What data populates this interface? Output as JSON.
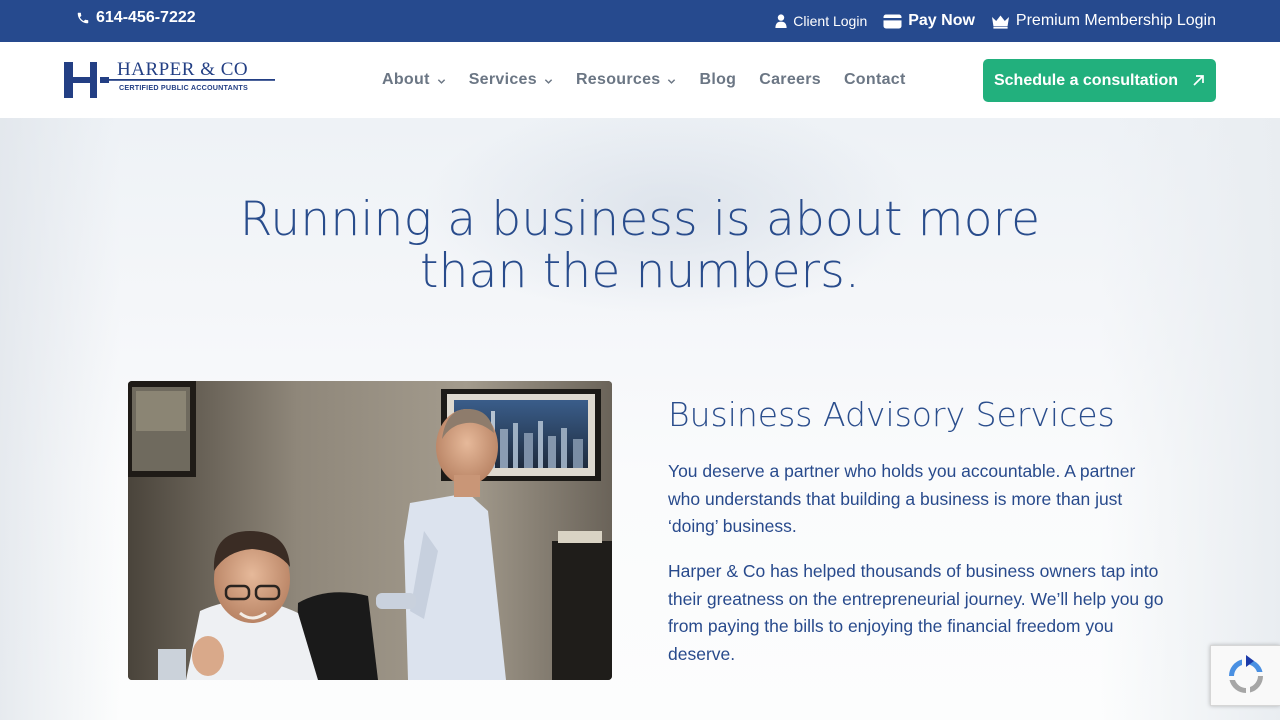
{
  "colors": {
    "topbar_bg": "#264a8e",
    "brand_navy": "#233f84",
    "nav_text": "#6b7684",
    "cta_green": "#22b07d",
    "heading_blue": "#294c8c"
  },
  "topbar": {
    "phone": "614-456-7222",
    "phone_icon": "phone-icon",
    "client_login": "Client Login",
    "client_login_icon": "user-icon",
    "pay_now": "Pay Now",
    "pay_now_icon": "credit-card-icon",
    "premium_login": "Premium Membership Login",
    "premium_login_icon": "crown-icon"
  },
  "header": {
    "logo_main": "HARPER & CO",
    "logo_sub": "CERTIFIED PUBLIC ACCOUNTANTS",
    "nav": [
      {
        "label": "About",
        "has_dropdown": true
      },
      {
        "label": "Services",
        "has_dropdown": true
      },
      {
        "label": "Resources",
        "has_dropdown": true
      },
      {
        "label": "Blog",
        "has_dropdown": false
      },
      {
        "label": "Careers",
        "has_dropdown": false
      },
      {
        "label": "Contact",
        "has_dropdown": false
      }
    ],
    "cta_label": "Schedule a consultation",
    "cta_icon": "arrow-up-right-icon"
  },
  "hero": {
    "title_line1": "Running a business is about more",
    "title_line2": "than the numbers."
  },
  "advisory": {
    "heading": "Business Advisory Services",
    "paragraph1": "You deserve a partner who holds you accountable. A partner who understands that building a business is more than just ‘doing’ business.",
    "paragraph2": "Harper & Co has helped thousands of business owners tap into their greatness on the entrepreneurial journey. We’ll help you go from paying the bills to enjoying the financial freedom you deserve."
  },
  "recaptcha": {
    "icon": "recaptcha-icon"
  }
}
